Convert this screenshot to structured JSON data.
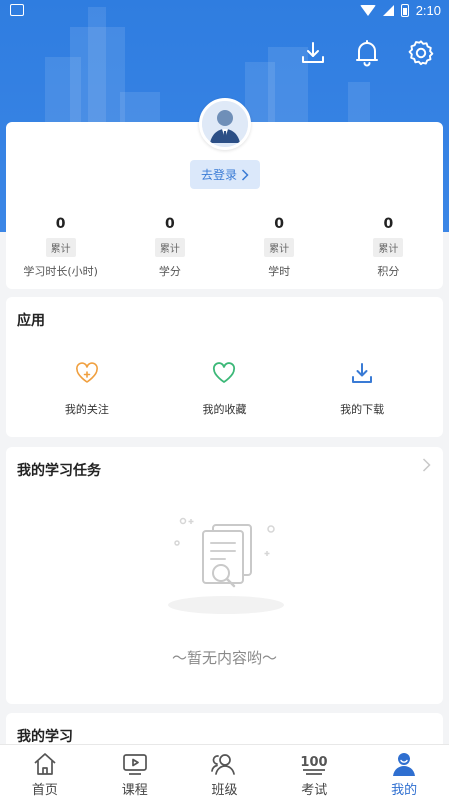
{
  "status_bar": {
    "time": "2:10"
  },
  "header": {
    "icons": [
      "download-icon",
      "bell-icon",
      "gear-icon"
    ]
  },
  "profile": {
    "login_label": "去登录",
    "stats": [
      {
        "value": "0",
        "badge": "累计",
        "label": "学习时长(小时)"
      },
      {
        "value": "0",
        "badge": "累计",
        "label": "学分"
      },
      {
        "value": "0",
        "badge": "累计",
        "label": "学时"
      },
      {
        "value": "0",
        "badge": "累计",
        "label": "积分"
      }
    ]
  },
  "apps": {
    "title": "应用",
    "items": [
      {
        "label": "我的关注",
        "icon": "heart-plus-icon",
        "color": "#f0a040"
      },
      {
        "label": "我的收藏",
        "icon": "heart-icon",
        "color": "#3cb878"
      },
      {
        "label": "我的下载",
        "icon": "download-icon",
        "color": "#3a7bd5"
      }
    ]
  },
  "tasks": {
    "title": "我的学习任务",
    "empty_text": "〜暂无内容哟〜"
  },
  "study": {
    "title": "我的学习"
  },
  "bottom_nav": {
    "items": [
      {
        "label": "首页",
        "icon": "home-icon"
      },
      {
        "label": "课程",
        "icon": "play-icon"
      },
      {
        "label": "班级",
        "icon": "group-icon"
      },
      {
        "label": "考试",
        "icon": "exam-icon"
      },
      {
        "label": "我的",
        "icon": "user-icon"
      }
    ],
    "active": "我的"
  },
  "colors": {
    "primary": "#2f7de0",
    "active": "#2f6fd0"
  }
}
